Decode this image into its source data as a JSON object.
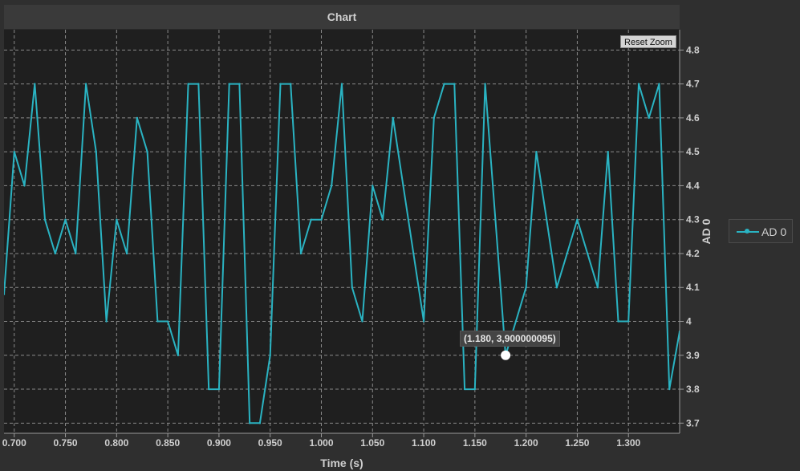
{
  "window_title": "Chart",
  "reset_zoom_label": "Reset Zoom",
  "tooltip_text": "(1.180, 3,900000095)",
  "colors": {
    "series": "#2ab3c2",
    "plot_bg": "#1f1f1f",
    "page_bg": "#2f2f2f",
    "grid": "#8a8a8a"
  },
  "chart_data": {
    "type": "line",
    "xlabel": "Time (s)",
    "ylabel": "AD 0",
    "xlim": [
      0.69,
      1.35
    ],
    "ylim": [
      3.67,
      4.86
    ],
    "x_ticks": [
      "0.700",
      "0.750",
      "0.800",
      "0.850",
      "0.900",
      "0.950",
      "1.000",
      "1.050",
      "1.100",
      "1.150",
      "1.200",
      "1.250",
      "1.300"
    ],
    "x_tick_values": [
      0.7,
      0.75,
      0.8,
      0.85,
      0.9,
      0.95,
      1.0,
      1.05,
      1.1,
      1.15,
      1.2,
      1.25,
      1.3
    ],
    "y_ticks": [
      "3.7",
      "3.8",
      "3.9",
      "4",
      "4.1",
      "4.2",
      "4.3",
      "4.4",
      "4.5",
      "4.6",
      "4.7",
      "4.8"
    ],
    "y_tick_values": [
      3.7,
      3.8,
      3.9,
      4.0,
      4.1,
      4.2,
      4.3,
      4.4,
      4.5,
      4.6,
      4.7,
      4.8
    ],
    "grid": true,
    "legend_position": "right",
    "series": [
      {
        "name": "AD 0",
        "x": [
          0.69,
          0.7,
          0.71,
          0.72,
          0.73,
          0.74,
          0.75,
          0.76,
          0.77,
          0.78,
          0.79,
          0.8,
          0.81,
          0.82,
          0.83,
          0.84,
          0.85,
          0.86,
          0.87,
          0.88,
          0.89,
          0.9,
          0.91,
          0.92,
          0.93,
          0.94,
          0.95,
          0.96,
          0.97,
          0.98,
          0.99,
          1.0,
          1.01,
          1.02,
          1.03,
          1.04,
          1.05,
          1.06,
          1.07,
          1.08,
          1.09,
          1.1,
          1.11,
          1.12,
          1.13,
          1.14,
          1.15,
          1.16,
          1.17,
          1.18,
          1.19,
          1.2,
          1.21,
          1.22,
          1.23,
          1.24,
          1.25,
          1.26,
          1.27,
          1.28,
          1.29,
          1.3,
          1.31,
          1.32,
          1.33,
          1.34,
          1.35
        ],
        "y": [
          4.08,
          4.5,
          4.4,
          4.7,
          4.3,
          4.2,
          4.3,
          4.2,
          4.7,
          4.5,
          4.0,
          4.3,
          4.2,
          4.6,
          4.5,
          4.0,
          4.0,
          3.9,
          4.7,
          4.7,
          3.8,
          3.8,
          4.7,
          4.7,
          3.7,
          3.7,
          3.9,
          4.7,
          4.7,
          4.2,
          4.3,
          4.3,
          4.4,
          4.7,
          4.1,
          4.0,
          4.4,
          4.3,
          4.6,
          4.4,
          4.2,
          4.0,
          4.6,
          4.7,
          4.7,
          3.8,
          3.8,
          4.7,
          4.3,
          3.9,
          4.0,
          4.1,
          4.5,
          4.3,
          4.1,
          4.2,
          4.3,
          4.2,
          4.1,
          4.5,
          4.0,
          4.0,
          4.7,
          4.6,
          4.7,
          3.8,
          3.97
        ]
      }
    ],
    "highlight_point": {
      "x": 1.18,
      "y": 3.9
    }
  }
}
